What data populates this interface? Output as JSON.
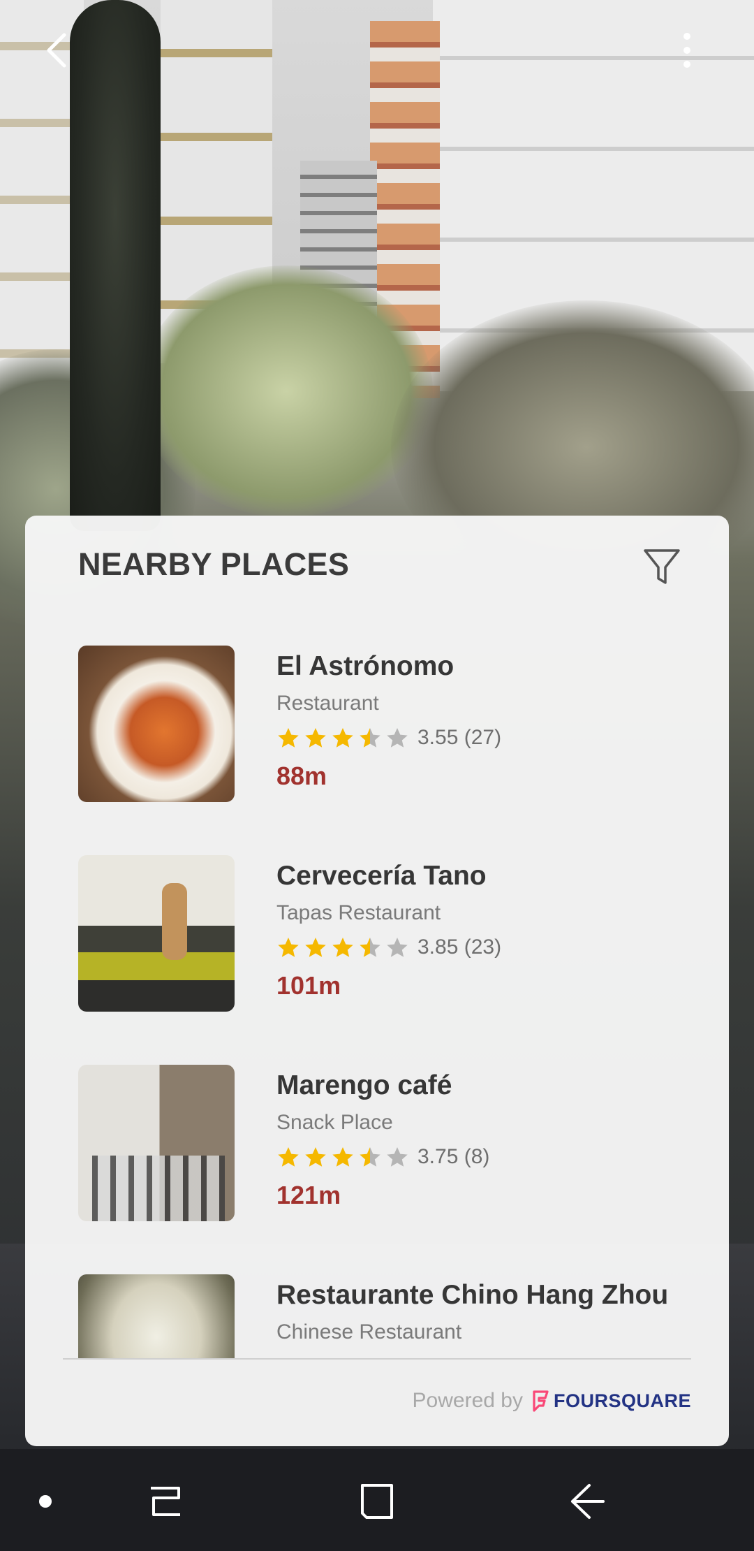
{
  "header": {
    "back_icon": "chevron-left-icon",
    "more_icon": "more-vertical-icon"
  },
  "card": {
    "title": "NEARBY PLACES",
    "filter_icon": "filter-icon"
  },
  "places": [
    {
      "name": "El Astrónomo",
      "category": "Restaurant",
      "rating": 3.5,
      "rating_text": "3.55 (27)",
      "distance": "88m"
    },
    {
      "name": "Cervecería Tano",
      "category": "Tapas Restaurant",
      "rating": 3.5,
      "rating_text": "3.85 (23)",
      "distance": "101m"
    },
    {
      "name": "Marengo café",
      "category": "Snack Place",
      "rating": 3.5,
      "rating_text": "3.75 (8)",
      "distance": "121m"
    },
    {
      "name": "Restaurante Chino Hang Zhou",
      "category": "Chinese Restaurant",
      "rating": null,
      "rating_text": "",
      "distance": ""
    }
  ],
  "footer": {
    "powered_by": "Powered by",
    "brand": "FOURSQUARE"
  },
  "colors": {
    "distance": "#a1322e",
    "star_filled": "#f5b800",
    "star_empty": "#b5b5b5",
    "brand_pink": "#f94877",
    "brand_navy": "#233384"
  },
  "system_nav": {
    "items": [
      "dot-icon",
      "recents-icon",
      "home-icon",
      "back-arrow-icon"
    ]
  }
}
